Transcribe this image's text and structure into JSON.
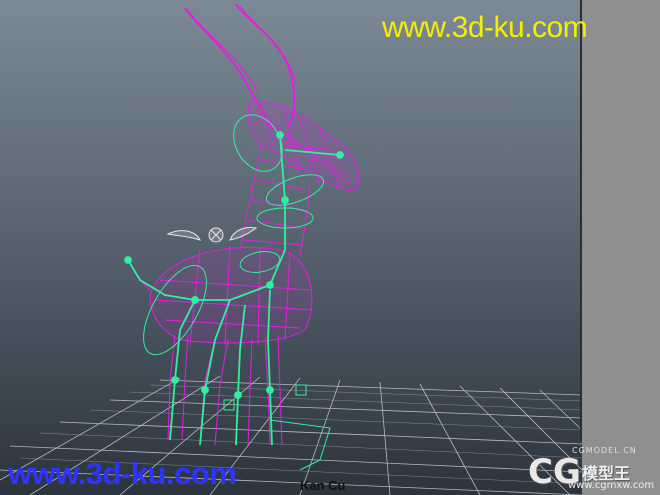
{
  "app": {
    "watermark_top": "www.3d-ku.com",
    "watermark_bottom": "www.3d-ku.com",
    "camera_label": "Kan Cu",
    "logo": {
      "brand": "CG",
      "chinese": "模型王",
      "url": "www.cgmxw.com",
      "top_text": "CGMODEL.CN"
    }
  },
  "colors": {
    "wireframe": "#e020e0",
    "rig": "#30f0a0",
    "grid": "#c8c8c8",
    "watermark_top": "#f5ee00",
    "watermark_bottom": "#2f33ff"
  },
  "icons": [
    "antelope-wireframe",
    "skeleton-rig",
    "eye-control-icon",
    "floor-grid"
  ]
}
